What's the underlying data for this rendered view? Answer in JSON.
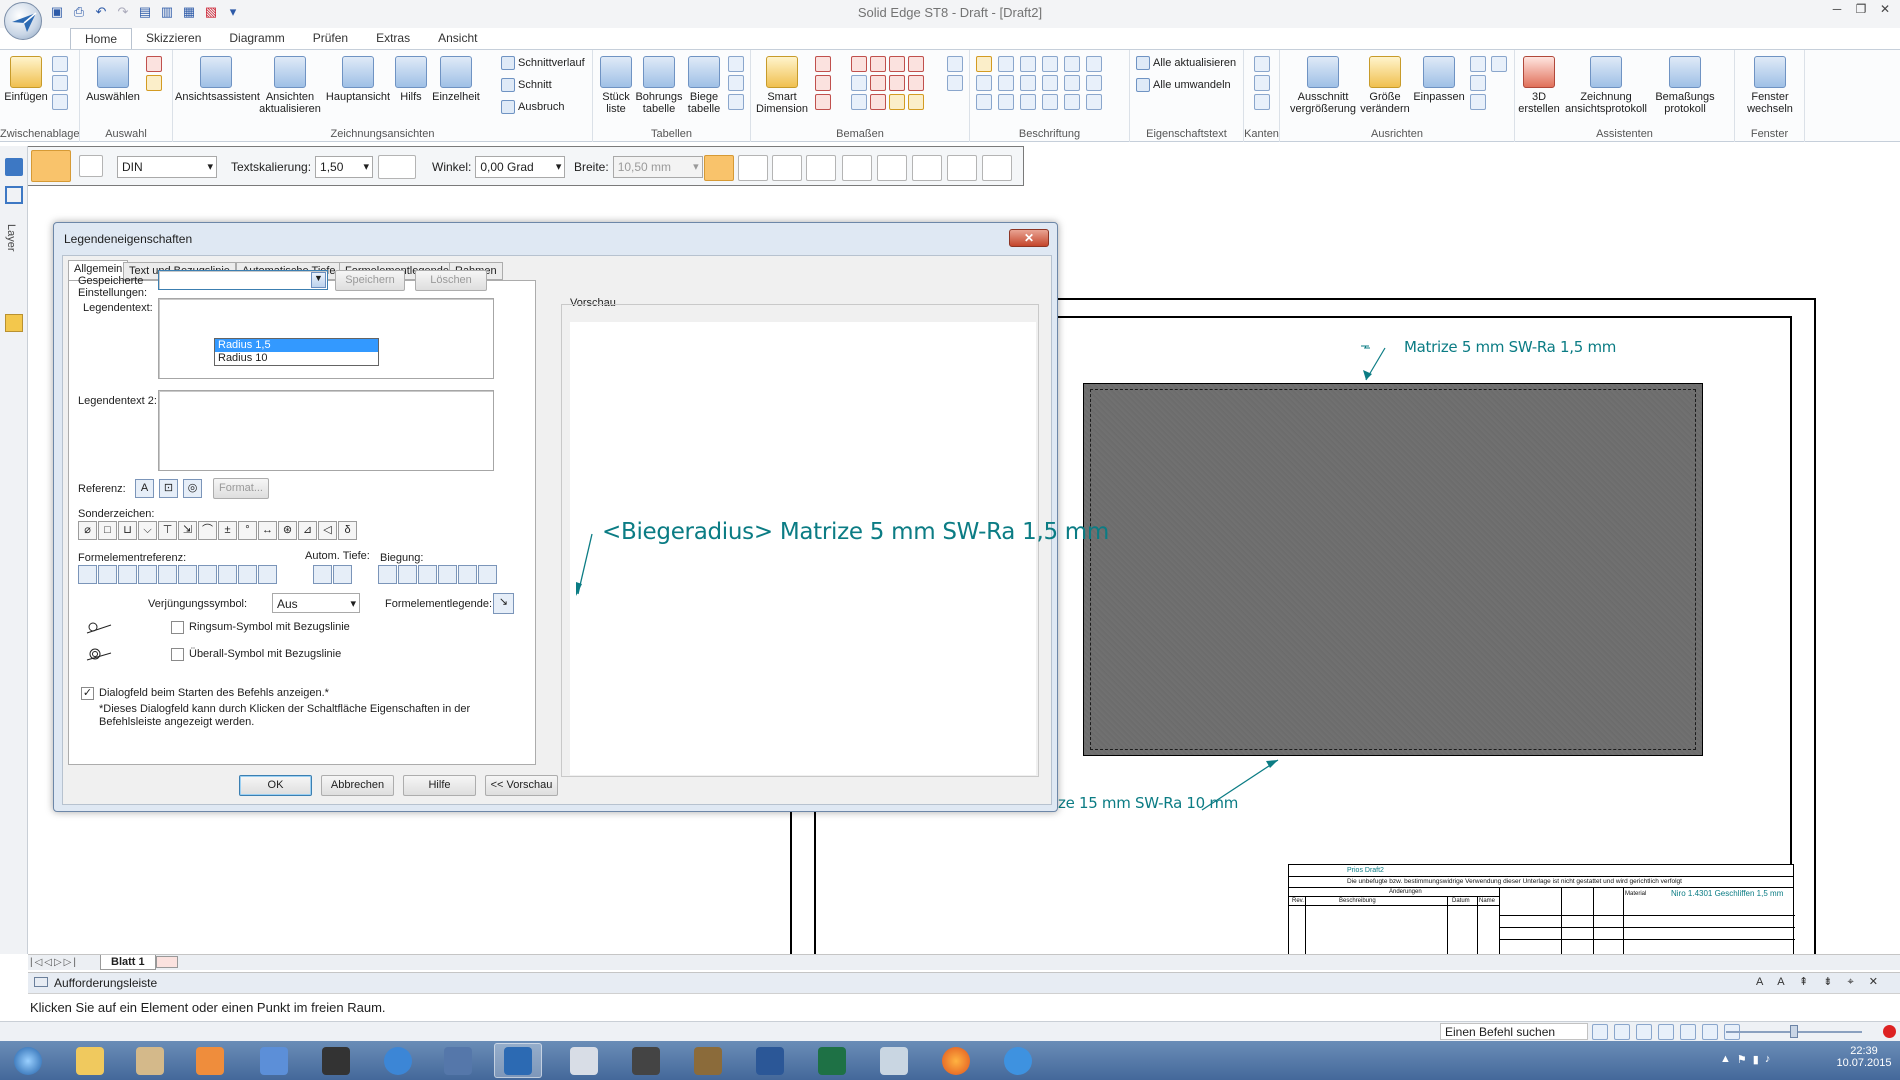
{
  "window": {
    "title": "Solid Edge ST8 - Draft - [Draft2]"
  },
  "ribbon": {
    "tabs": [
      "Home",
      "Skizzieren",
      "Diagramm",
      "Prüfen",
      "Extras",
      "Ansicht"
    ],
    "active_tab": "Home",
    "groups": {
      "clipboard": {
        "label": "Zwischenablage",
        "paste": "Einfügen"
      },
      "select": {
        "label": "Auswahl",
        "select": "Auswählen"
      },
      "views": {
        "label": "Zeichnungsansichten",
        "view_wizard": "Ansichtsassistent",
        "update_views": "Ansichten aktualisieren",
        "main_view": "Hauptansicht",
        "aux": "Hilfs",
        "detail": "Einzelheit",
        "section_line": "Schnittverlauf",
        "section": "Schnitt",
        "breakout": "Ausbruch"
      },
      "tables": {
        "label": "Tabellen",
        "parts_list": "Stück liste",
        "hole_table": "Bohrungs tabelle",
        "bend_table": "Biege tabelle"
      },
      "dims": {
        "label": "Bemaßen",
        "smart_dim": "Smart Dimension"
      },
      "annot": {
        "label": "Beschriftung"
      },
      "proptext": {
        "label": "Eigenschaftstext",
        "update_all": "Alle aktualisieren",
        "convert_all": "Alle umwandeln"
      },
      "edges": {
        "label": "Kanten"
      },
      "align": {
        "label": "Ausrichten",
        "zoom_area": "Ausschnitt vergrößerung",
        "resize": "Größe verändern",
        "fit": "Einpassen"
      },
      "assist": {
        "label": "Assistenten",
        "create3d": "3D erstellen",
        "drawing_view_log": "Zeichnung ansichtsprotokoll",
        "dim_log": "Bemaßungs protokoll"
      },
      "window": {
        "label": "Fenster",
        "switch_window": "Fenster wechseln"
      }
    }
  },
  "command_bar": {
    "standard": "DIN",
    "text_scale_label": "Textskalierung:",
    "text_scale": "1,50",
    "angle_label": "Winkel:",
    "angle": "0,00 Grad",
    "width_label": "Breite:",
    "width": "10,50 mm"
  },
  "left_bar": {
    "layer_label": "Layer"
  },
  "dialog": {
    "title": "Legendeneigenschaften",
    "tabs": [
      "Allgemein",
      "Text und Bezugslinie",
      "Automatische Tiefe",
      "Formelementlegende",
      "Rahmen"
    ],
    "saved_settings_label_1": "Gespeicherte",
    "saved_settings_label_2": "Einstellungen:",
    "saved_settings_value": "",
    "saved_settings_options": [
      "Radius 1,5",
      "Radius 10"
    ],
    "save_btn": "Speichern",
    "delete_btn": "Löschen",
    "callout_text_label": "Legendentext:",
    "callout_text2_label": "Legendentext 2:",
    "reference_label": "Referenz:",
    "format_btn": "Format...",
    "special_chars_label": "Sonderzeichen:",
    "special_chars": [
      "⌀",
      "□",
      "⊔",
      "⌵",
      "⊤",
      "⇲",
      "⌒",
      "±",
      "°",
      "↔",
      "⊛",
      "⊿",
      "◁",
      "δ"
    ],
    "feature_ref_label": "Formelementreferenz:",
    "auto_depth_label": "Autom. Tiefe:",
    "bend_label": "Biegung:",
    "taper_label": "Verjüngungssymbol:",
    "taper_value": "Aus",
    "feature_callout_label": "Formelementlegende:",
    "all_around_label": "Ringsum-Symbol mit Bezugslinie",
    "all_over_label": "Überall-Symbol mit Bezugslinie",
    "show_dialog_label": "Dialogfeld beim Starten des Befehls anzeigen.*",
    "note_line1": "*Dieses Dialogfeld kann durch Klicken der Schaltfläche Eigenschaften in der",
    "note_line2": "Befehlsleiste angezeigt werden.",
    "preview_label": "Vorschau",
    "preview_text": "<Biegeradius> Matrize 5 mm SW-Ra 1,5 mm",
    "ok": "OK",
    "cancel": "Abbrechen",
    "help": "Hilfe",
    "preview_btn": "<< Vorschau"
  },
  "drawing": {
    "callout_top": "Matrize 5 mm SW-Ra 1,5 mm",
    "callout_bottom": "ze 15 mm SW-Ra 10 mm",
    "title_block": {
      "file": "Prios Draft2",
      "notice": "Die unbefugte bzw. bestimmungswidrige Verwendung dieser Unterlage ist nicht gestattet und wird gerichtlich verfolgt",
      "changes": "Änderungen",
      "rev": "Rev.",
      "desc": "Beschreibung",
      "date": "Datum",
      "name": "Name",
      "material_label": "Material",
      "material": "Niro 1.4301 Geschliffen 1,5 mm"
    }
  },
  "sheet_tab": "Blatt 1",
  "prompt": {
    "title": "Aufforderungsleiste",
    "message": "Klicken Sie auf ein Element oder einen Punkt im freien Raum."
  },
  "status": {
    "search_placeholder": "Einen Befehl suchen"
  },
  "taskbar": {
    "time": "22:39",
    "date": "10.07.2015"
  }
}
